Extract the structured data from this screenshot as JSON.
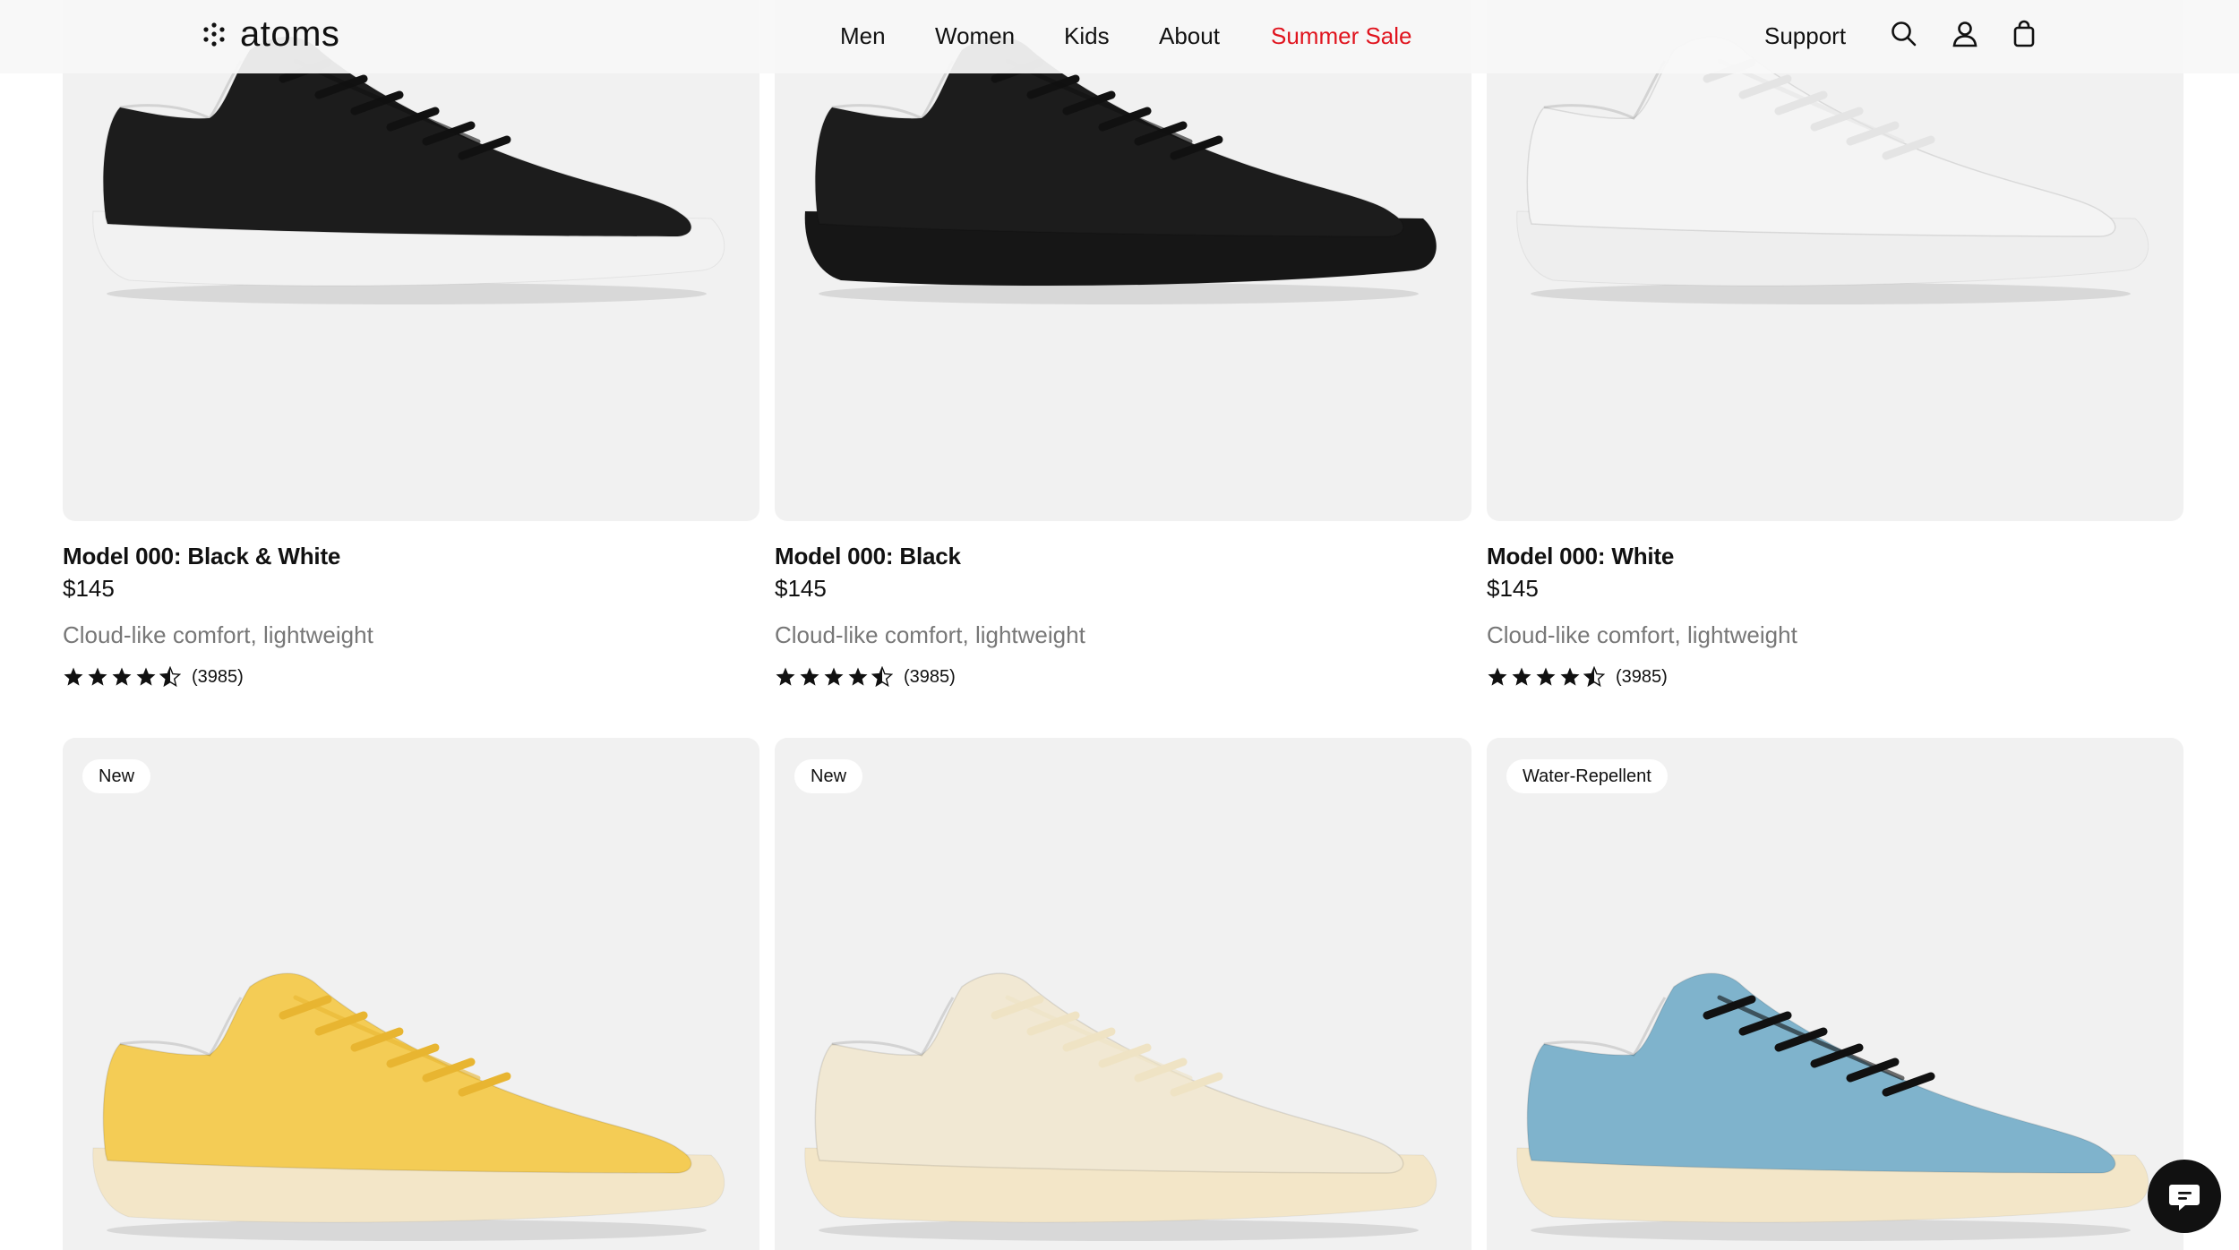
{
  "brand": {
    "name": "atoms"
  },
  "nav": {
    "men": "Men",
    "women": "Women",
    "kids": "Kids",
    "about": "About",
    "sale": "Summer Sale",
    "support": "Support"
  },
  "icons": {
    "search": "search-icon",
    "account": "user-icon",
    "cart": "shopping-bag-icon",
    "chat": "chat-icon"
  },
  "colors": {
    "sale": "#e0141e",
    "card_bg": "#f1f1f1"
  },
  "products": [
    {
      "title": "Model 000: Black & White",
      "price": "$145",
      "tagline": "Cloud-like comfort, lightweight",
      "rating": 4.5,
      "reviews": "(3985)",
      "badge": "",
      "upper_color": "#1c1c1c",
      "sole_color": "#f2f2f2",
      "lace_color": "#111111"
    },
    {
      "title": "Model 000: Black",
      "price": "$145",
      "tagline": "Cloud-like comfort, lightweight",
      "rating": 4.5,
      "reviews": "(3985)",
      "badge": "",
      "upper_color": "#1c1c1c",
      "sole_color": "#161616",
      "lace_color": "#111111"
    },
    {
      "title": "Model 000: White",
      "price": "$145",
      "tagline": "Cloud-like comfort, lightweight",
      "rating": 4.5,
      "reviews": "(3985)",
      "badge": "",
      "upper_color": "#f4f4f4",
      "sole_color": "#eeeeee",
      "lace_color": "#e4e4e4"
    },
    {
      "badge": "New",
      "upper_color": "#f4cc55",
      "sole_color": "#f3e6c8",
      "lace_color": "#e8b531"
    },
    {
      "badge": "New",
      "upper_color": "#f1e8d3",
      "sole_color": "#f3e6c8",
      "lace_color": "#efe3c4"
    },
    {
      "badge": "Water-Repellent",
      "upper_color": "#7fb3cc",
      "sole_color": "#f3e6c8",
      "lace_color": "#111111"
    }
  ]
}
